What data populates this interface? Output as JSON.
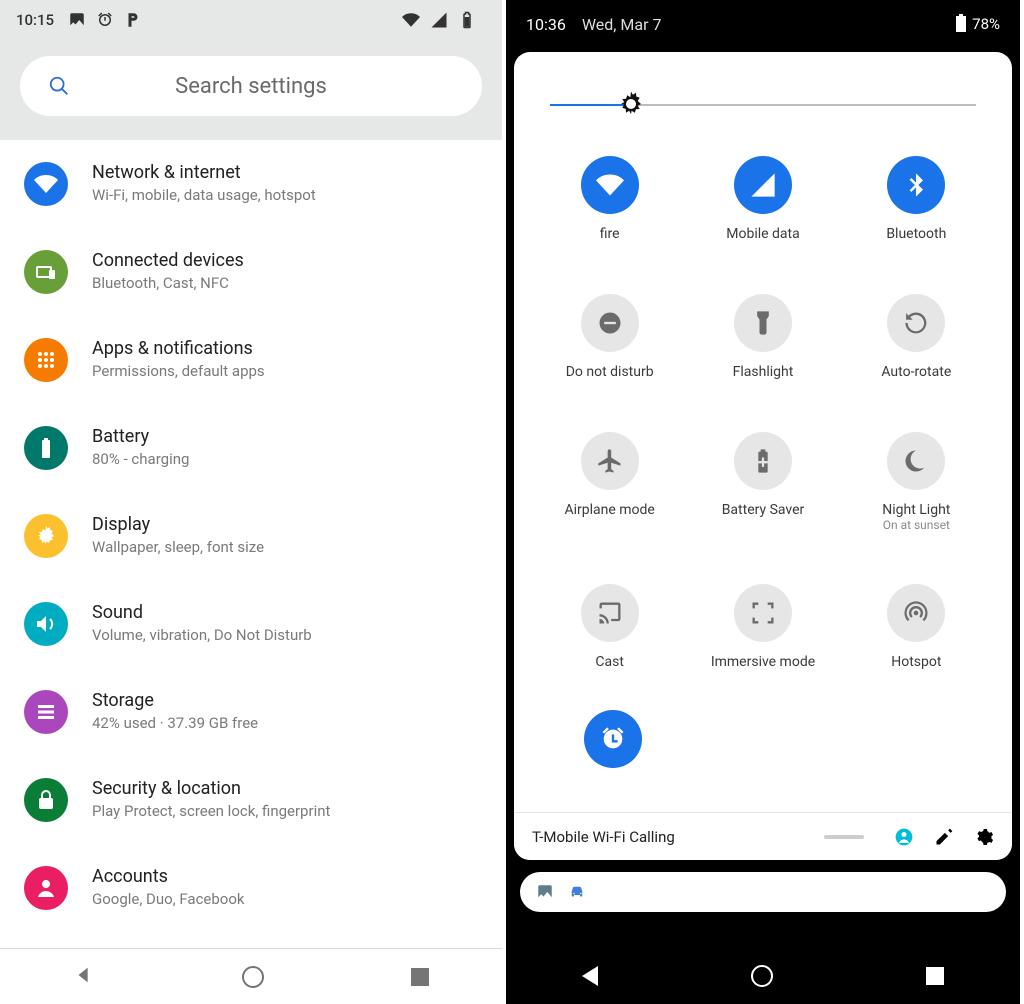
{
  "left_phone": {
    "status_bar": {
      "time": "10:15"
    },
    "search_placeholder": "Search settings",
    "items": [
      {
        "title": "Network & internet",
        "subtitle": "Wi-Fi, mobile, data usage, hotspot",
        "color": "#1a73e8",
        "icon": "wifi"
      },
      {
        "title": "Connected devices",
        "subtitle": "Bluetooth, Cast, NFC",
        "color": "#689f38",
        "icon": "devices"
      },
      {
        "title": "Apps & notifications",
        "subtitle": "Permissions, default apps",
        "color": "#f57c00",
        "icon": "apps"
      },
      {
        "title": "Battery",
        "subtitle": "80% - charging",
        "color": "#00796b",
        "icon": "battery"
      },
      {
        "title": "Display",
        "subtitle": "Wallpaper, sleep, font size",
        "color": "#fbc02d",
        "icon": "brightness"
      },
      {
        "title": "Sound",
        "subtitle": "Volume, vibration, Do Not Disturb",
        "color": "#00acc1",
        "icon": "volume"
      },
      {
        "title": "Storage",
        "subtitle": "42% used · 37.39 GB free",
        "color": "#ab47bc",
        "icon": "storage"
      },
      {
        "title": "Security & location",
        "subtitle": "Play Protect, screen lock, fingerprint",
        "color": "#0a7e36",
        "icon": "lock"
      },
      {
        "title": "Accounts",
        "subtitle": "Google, Duo, Facebook",
        "color": "#e91e63",
        "icon": "account"
      }
    ]
  },
  "right_phone": {
    "status_bar": {
      "time": "10:36",
      "date": "Wed, Mar 7",
      "battery_pct": "78%"
    },
    "brightness_pct": 18,
    "tiles": [
      {
        "label": "fire",
        "on": true,
        "icon": "wifi"
      },
      {
        "label": "Mobile data",
        "on": true,
        "icon": "signal"
      },
      {
        "label": "Bluetooth",
        "on": true,
        "icon": "bluetooth"
      },
      {
        "label": "Do not disturb",
        "on": false,
        "icon": "dnd"
      },
      {
        "label": "Flashlight",
        "on": false,
        "icon": "flashlight"
      },
      {
        "label": "Auto-rotate",
        "on": false,
        "icon": "rotate"
      },
      {
        "label": "Airplane mode",
        "on": false,
        "icon": "airplane"
      },
      {
        "label": "Battery Saver",
        "on": false,
        "icon": "batt_saver"
      },
      {
        "label": "Night Light",
        "on": false,
        "icon": "night",
        "sub": "On at sunset"
      },
      {
        "label": "Cast",
        "on": false,
        "icon": "cast"
      },
      {
        "label": "Immersive mode",
        "on": false,
        "icon": "immersive"
      },
      {
        "label": "Hotspot",
        "on": false,
        "icon": "hotspot"
      }
    ],
    "extra_tile": {
      "on": true,
      "icon": "alarm"
    },
    "footer_carrier": "T-Mobile Wi-Fi Calling"
  }
}
